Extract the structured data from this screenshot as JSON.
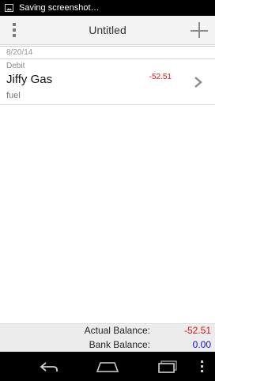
{
  "status_bar": {
    "notification_icon": "image-icon",
    "text": "Saving screenshot…"
  },
  "action_bar": {
    "menu_icon": "overflow-menu-icon",
    "title": "Untitled",
    "add_icon": "plus-icon"
  },
  "date_header": "8/20/14",
  "transactions": [
    {
      "type": "Debit",
      "name": "Jiffy Gas",
      "memo": "fuel",
      "amount": "-52.51",
      "amount_color": "#e01010"
    }
  ],
  "balances": {
    "actual_label": "Actual Balance:",
    "actual_value": "-52.51",
    "actual_color": "#e01010",
    "bank_label": "Bank Balance:",
    "bank_value": "0.00",
    "bank_color": "#1010d0"
  },
  "nav_bar": {
    "buttons": [
      "back-icon",
      "home-icon",
      "recents-icon",
      "menu-icon"
    ]
  }
}
